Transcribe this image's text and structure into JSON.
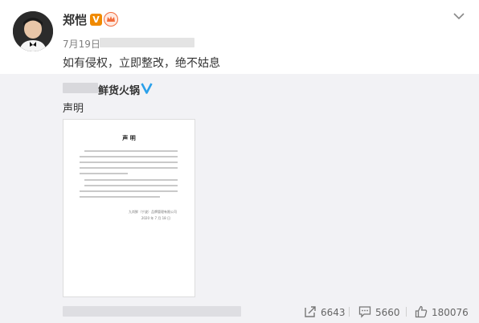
{
  "post": {
    "author": "郑恺",
    "verified_badge": "V",
    "time": "7月19日",
    "text": "如有侵权，立即整改，绝不姑息"
  },
  "repost": {
    "author_suffix": "鲜货火锅",
    "text": "声明",
    "document": {
      "title": "声 明",
      "signature_company": "九尚鲜（宁波）品牌管理有限公司",
      "signature_date": "2020 年 7 月 18 日"
    }
  },
  "actions": {
    "repost_count": "6643",
    "comment_count": "5660",
    "like_count": "180076"
  },
  "colors": {
    "accent_orange": "#f08a00",
    "verified_blue": "#2aa0ea",
    "repost_background": "#f2f2f5"
  },
  "icons": [
    "crown-icon",
    "chevron-down-icon",
    "blue-v-icon",
    "repost-icon",
    "comment-icon",
    "like-icon"
  ]
}
